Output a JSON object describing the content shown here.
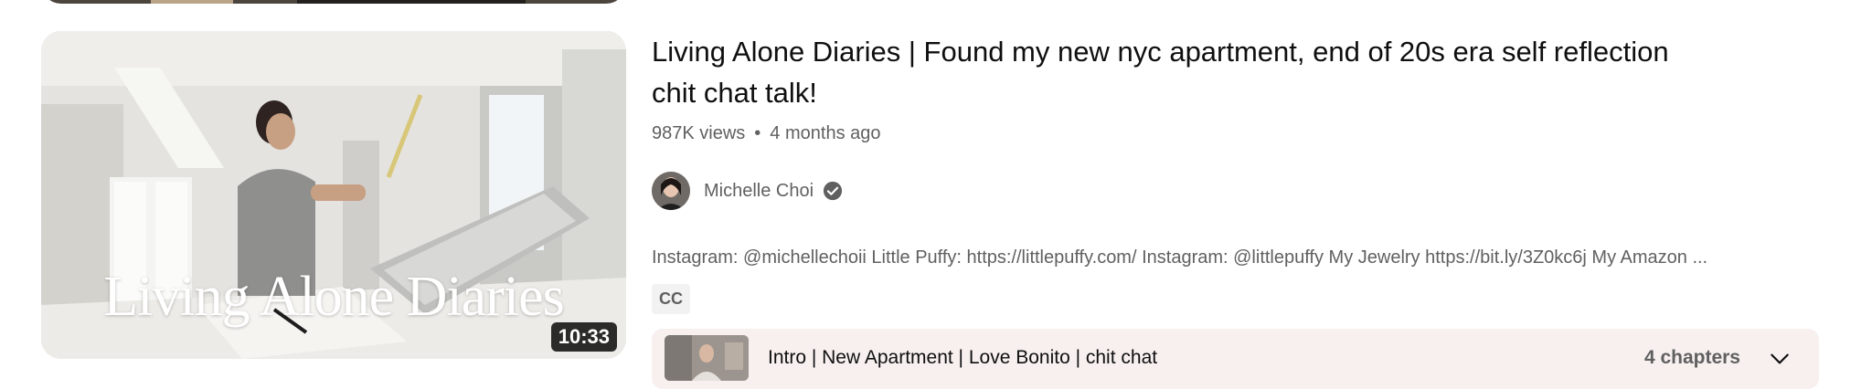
{
  "video": {
    "thumbnail_text": "Living Alone Diaries",
    "duration": "10:33",
    "title_line1": "Living Alone Diaries | Found my new nyc apartment, end of 20s era self reflection",
    "title_line2": "chit chat talk!",
    "views": "987K views",
    "separator": "•",
    "age": "4 months ago",
    "channel": "Michelle Choi",
    "description": "Instagram: @michellechoii Little Puffy: https://littlepuffy.com/ Instagram: @littlepuffy My Jewelry https://bit.ly/3Z0kc6j My Amazon ...",
    "badge": "CC"
  },
  "chapters": {
    "label": "Intro | New Apartment | Love Bonito | chit chat",
    "count": "4 chapters"
  },
  "colors": {
    "text_primary": "#0f0f0f",
    "text_secondary": "#606060",
    "chapters_bg": "#f7f0ef",
    "badge_bg": "#f2f2f2"
  },
  "icons": [
    "verified-check-icon",
    "chevron-down-icon"
  ]
}
